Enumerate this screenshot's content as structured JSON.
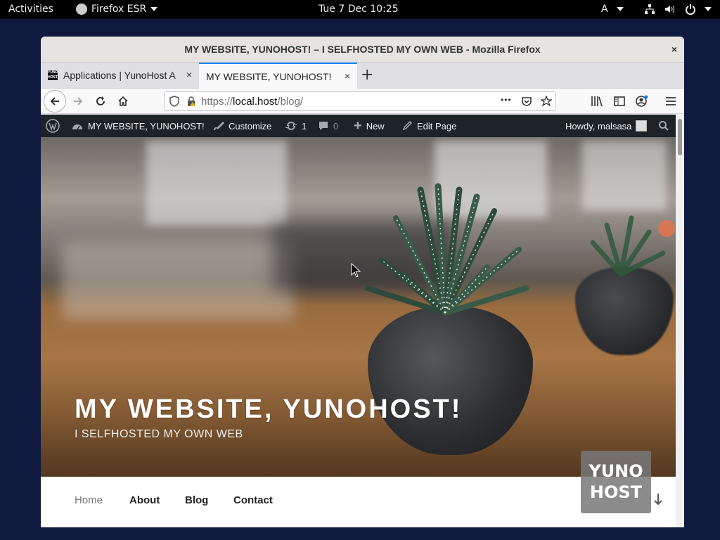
{
  "system_bar": {
    "activities": "Activities",
    "app_menu": "Firefox ESR",
    "clock": "Tue 7 Dec 10:25",
    "input_method": "A"
  },
  "window": {
    "title": "MY WEBSITE, YUNOHOST! – I SELFHOSTED MY OWN WEB - Mozilla Firefox",
    "close": "×"
  },
  "tabs": [
    {
      "label": "Applications | YunoHost A",
      "favicon": "YUNO HOST",
      "close": "×"
    },
    {
      "label": "MY WEBSITE, YUNOHOST!",
      "close": "×",
      "active": true
    }
  ],
  "new_tab": "+",
  "navbar": {
    "url_scheme": "https://",
    "url_host": "local.host",
    "url_path": "/blog/",
    "page_actions": "•••"
  },
  "admin_bar": {
    "site_name": "MY WEBSITE, YUNOHOST!",
    "customize": "Customize",
    "updates_count": "1",
    "comments_count": "0",
    "new": "New",
    "edit_page": "Edit Page",
    "howdy": "Howdy, malsasa"
  },
  "hero": {
    "title": "MY WEBSITE, YUNOHOST!",
    "description": "I SELFHOSTED MY OWN WEB"
  },
  "menu": {
    "items": [
      "Home",
      "About",
      "Blog",
      "Contact"
    ]
  },
  "yunohost_logo": "YUNO HOST",
  "colors": {
    "desktop_bg": "#0f1a3e",
    "admin_bar": "#1d2327",
    "active_tab_accent": "#0a84ff"
  }
}
